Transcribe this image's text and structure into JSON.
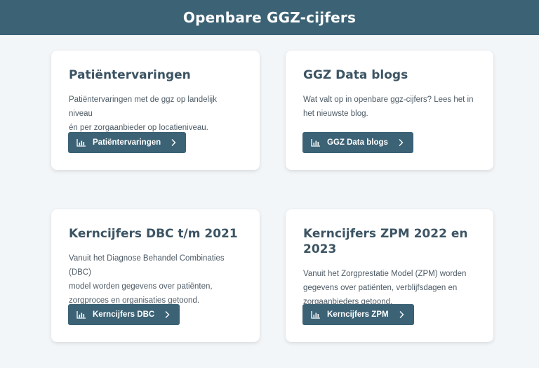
{
  "header": {
    "title": "Openbare GGZ-cijfers"
  },
  "cards": [
    {
      "title": "Patiëntervaringen",
      "lines": [
        "Patiëntervaringen met de ggz op landelijk niveau",
        "én per zorgaanbieder op locatieniveau."
      ],
      "button": {
        "label": "Patiëntervaringen",
        "icon": "bar-chart-icon",
        "trail_icon": "chevron-right-icon"
      }
    },
    {
      "title": "GGZ Data blogs",
      "lines": [
        "Wat valt op in openbare ggz-cijfers? Lees het in",
        "het nieuwste blog."
      ],
      "button": {
        "label": "GGZ Data blogs",
        "icon": "bar-chart-icon",
        "trail_icon": "chevron-right-icon"
      }
    },
    {
      "title": "Kerncijfers DBC t/m 2021",
      "lines": [
        "Vanuit het Diagnose Behandel Combinaties (DBC)",
        "model worden gegevens over patiënten,",
        "zorgproces en organisaties getoond."
      ],
      "button": {
        "label": "Kerncijfers DBC",
        "icon": "bar-chart-icon",
        "trail_icon": "chevron-right-icon"
      }
    },
    {
      "title": "Kerncijfers ZPM 2022 en 2023",
      "lines": [
        "Vanuit het Zorgprestatie Model (ZPM) worden",
        "gegevens over patiënten, verblijfsdagen en",
        "zorgaanbieders getoond."
      ],
      "button": {
        "label": "Kerncijfers ZPM",
        "icon": "bar-chart-icon",
        "trail_icon": "chevron-right-icon"
      }
    }
  ],
  "colors": {
    "header_bg": "#3c6275",
    "button_bg": "#3c6275",
    "page_bg": "#f3f6f8",
    "card_bg": "#ffffff",
    "title": "#3c5463"
  }
}
